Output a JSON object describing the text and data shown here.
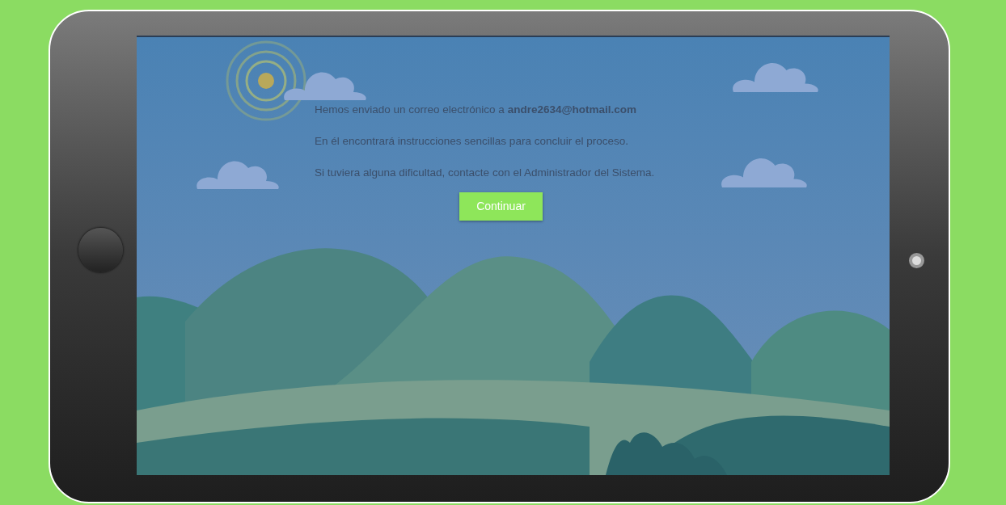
{
  "screen": {
    "messages": [
      "Hemos enviado un correo electrónico a **andre2634@hotmail.com**",
      "En él encontrará instrucciones sencillas para concluir el proceso.",
      "Si tuviera alguna dificultad, contacte con el Administrador del Sistema."
    ],
    "continue_button": "Continuar"
  }
}
